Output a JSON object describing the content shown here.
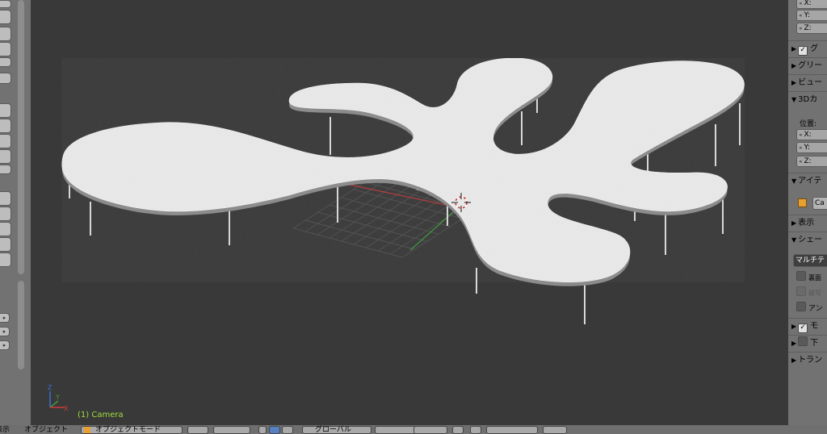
{
  "viewport": {
    "camera_label": "(1) Camera",
    "axis": {
      "x": "X",
      "y": "Y",
      "z": "Z"
    },
    "colors": {
      "background": "#393939",
      "plane": "#e9e9e9",
      "grid": "#4e4e4e",
      "x_axis": "#b23a3a",
      "y_axis": "#3d9a3d",
      "label": "#9fdf3a"
    }
  },
  "right_panel": {
    "rotation_fields": [
      "X:",
      "Y:",
      "Z:"
    ],
    "sections": {
      "grease": "グ",
      "grid": "グリー",
      "view": "ビュー",
      "cursor3d": "3Dカ",
      "item": "アイテ",
      "display": "表示",
      "shading": "シェー",
      "motion": "モ",
      "lower": "下",
      "transform": "トラン"
    },
    "position_label": "位置:",
    "cursor_fields": [
      "X:",
      "Y:",
      "Z:"
    ],
    "item_name": "Ca",
    "shading_mode": "マルチテ",
    "options": [
      "裏面",
      "被写",
      "アン"
    ]
  },
  "bottom_bar": {
    "view_menu": "表示",
    "select_menu": "オブジェクト",
    "mode": "オブジェクトモード",
    "orientation": "グローバル"
  }
}
